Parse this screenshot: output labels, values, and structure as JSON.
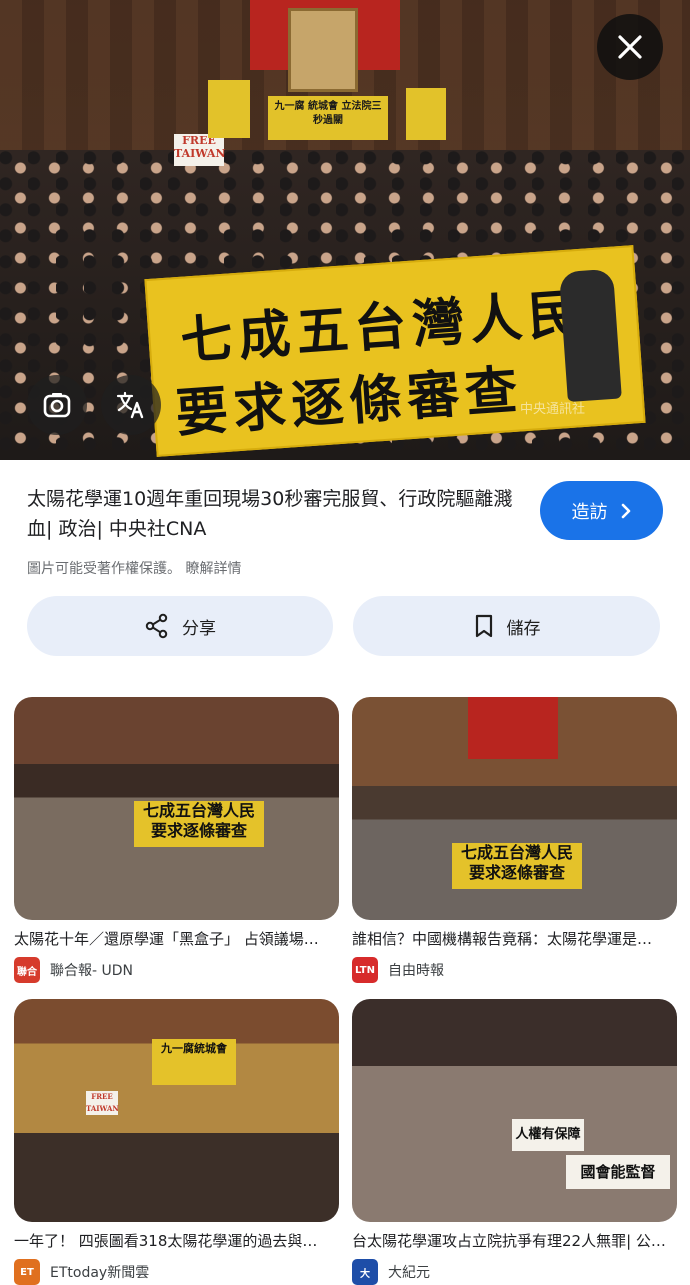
{
  "hero": {
    "banner_line1": "七成五台灣人民",
    "banner_line2": "要求逐條審查",
    "sign_free_taiwan": "FREE TAIWAN",
    "sign_topleft": "九一腐 統城會 立法院三秒過關",
    "watermark": "中央通訊社"
  },
  "result": {
    "title": "太陽花學運10週年重回現場30秒審完服貿、行政院驅離濺血| 政治| 中央社CNA",
    "copyright_note": "圖片可能受著作權保護。 瞭解詳情",
    "visit_label": "造訪"
  },
  "actions": {
    "share_label": "分享",
    "save_label": "儲存"
  },
  "related": [
    {
      "caption": "太陽花十年／還原學運「黑盒子」 占領議場…",
      "source": "聯合報- UDN",
      "logo_text": "聯合",
      "logo_color": "#d63b2c",
      "banner_line1": "七成五台灣人民",
      "banner_line2": "要求逐條審查"
    },
    {
      "caption": "誰相信？中國機構報告竟稱：太陽花學運是…",
      "source": "自由時報",
      "logo_text": "LTN",
      "logo_color": "#d72b2b",
      "banner_line1": "七成五台灣人民",
      "banner_line2": "要求逐條審查"
    },
    {
      "caption": "一年了！ 四張圖看318太陽花學運的過去與…",
      "source": "ETtoday新聞雲",
      "logo_text": "ET",
      "logo_color": "#e0701f",
      "banner_line1": "九一腐統城會",
      "banner_line2": "FREE TAIWAN"
    },
    {
      "caption": "台太陽花學運攻占立院抗爭有理22人無罪| 公…",
      "source": "大紀元",
      "logo_text": "大",
      "logo_color": "#1e4ea8",
      "banner_line1": "人權有保障",
      "banner_line2": "國會能監督"
    }
  ]
}
